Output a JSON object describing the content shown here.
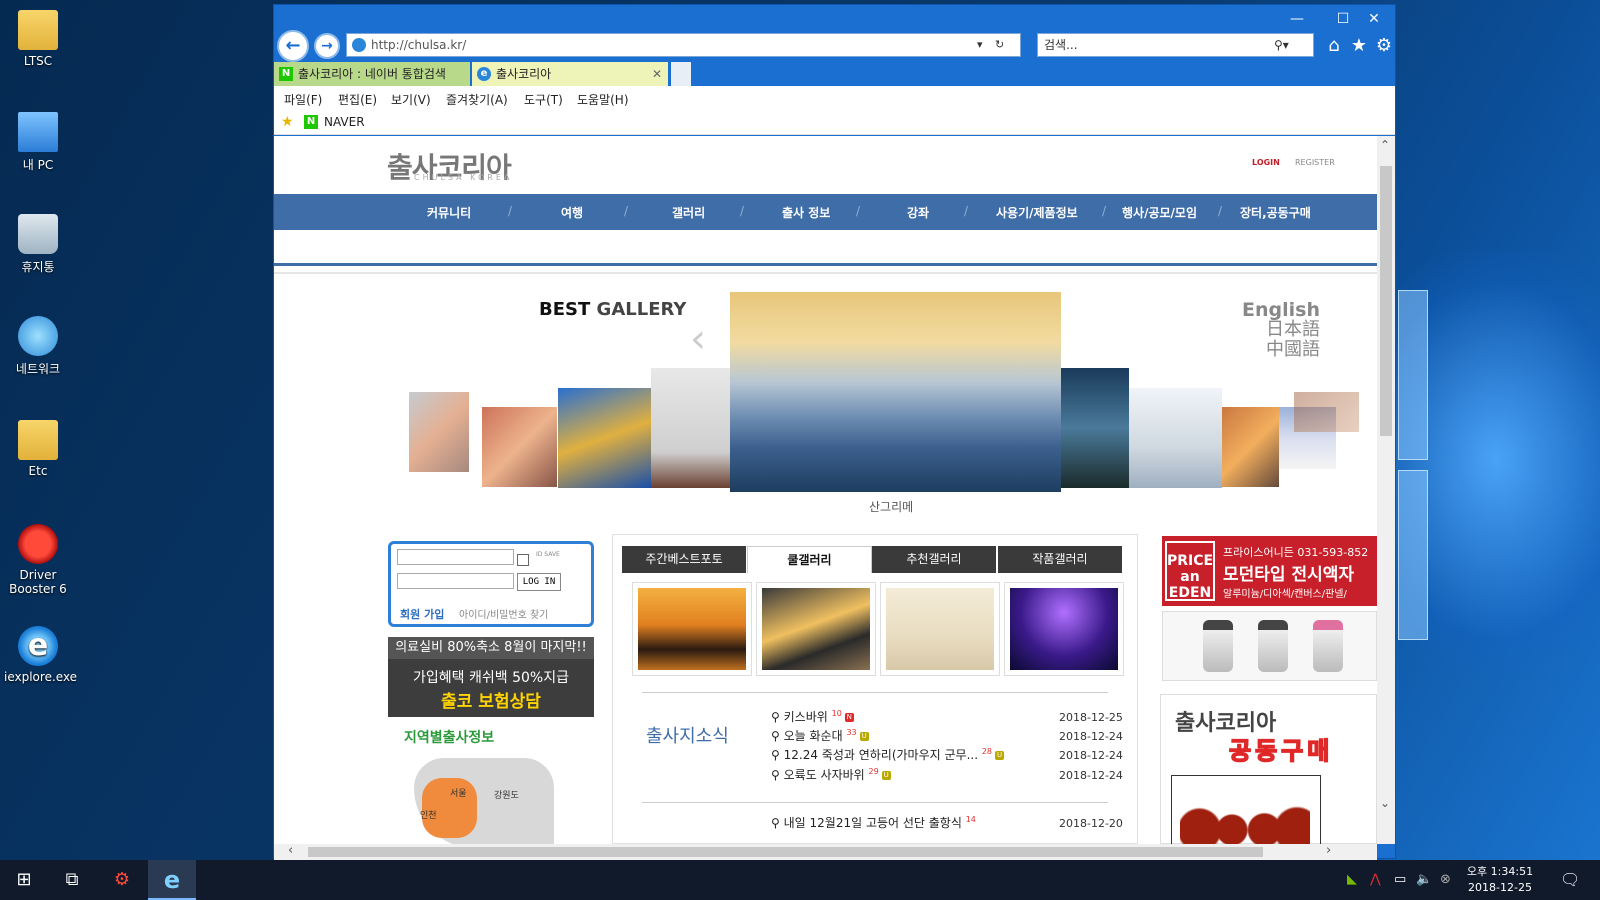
{
  "desktop": {
    "icons": [
      {
        "label": "LTSC",
        "icon": "folder-user-icon"
      },
      {
        "label": "내 PC",
        "icon": "computer-icon"
      },
      {
        "label": "휴지통",
        "icon": "recycle-bin-icon"
      },
      {
        "label": "네트워크",
        "icon": "network-icon"
      },
      {
        "label": "Etc",
        "icon": "folder-icon"
      },
      {
        "label": "Driver Booster 6",
        "icon": "driver-booster-icon"
      },
      {
        "label": "iexplore.exe",
        "icon": "internet-explorer-icon"
      }
    ]
  },
  "browser": {
    "address": "http://chulsa.kr/",
    "search_placeholder": "검색...",
    "tabs": [
      {
        "label": "출사코리아 : 네이버 통합검색",
        "favicon": "N"
      },
      {
        "label": "출사코리아",
        "favicon": "e"
      }
    ],
    "menu": [
      "파일(F)",
      "편집(E)",
      "보기(V)",
      "즐겨찾기(A)",
      "도구(T)",
      "도움말(H)"
    ],
    "favorites": [
      {
        "label": "NAVER",
        "icon": "N"
      }
    ]
  },
  "site": {
    "logo": "출사코리아",
    "logo_sub": "CHULSA KOREA",
    "login": "LOGIN",
    "register": "REGISTER",
    "nav": [
      "커뮤니티",
      "여행",
      "갤러리",
      "출사 정보",
      "강좌",
      "사용기/제품정보",
      "행사/공모/모임",
      "장터,공동구매"
    ],
    "best_gallery": {
      "best": "BEST",
      "gallery": "GALLERY"
    },
    "langs": [
      "English",
      "日本語",
      "中國語"
    ],
    "featured_caption": "산그리메",
    "login_box": {
      "id_save": "ID SAVE",
      "button": "LOG IN",
      "join": "회원 가입",
      "find": "아이디/비밀번호 찾기"
    },
    "insurance": {
      "line1": "의료실비 80%축소 8월이 마지막!!",
      "line2": "가입혜택 캐쉬백 50%지급",
      "line3": "출코 보험상담"
    },
    "region_title": "지역별출사정보",
    "map_labels": [
      "서울",
      "인천",
      "강원도"
    ],
    "gallery_tabs": [
      "주간베스트포토",
      "쿨갤러리",
      "추천갤러리",
      "작품갤러리"
    ],
    "news_title": "출사지소식",
    "news": [
      {
        "title": "키스바위",
        "count": "10",
        "badge": "N",
        "date": "2018-12-25"
      },
      {
        "title": "오늘 화순대",
        "count": "33",
        "badge": "U",
        "date": "2018-12-24"
      },
      {
        "title": "12.24 죽성과 연하리(가마우지 군무...",
        "count": "28",
        "badge": "U",
        "date": "2018-12-24"
      },
      {
        "title": "오륙도 사자바위",
        "count": "29",
        "badge": "U",
        "date": "2018-12-24"
      },
      {
        "title": "내일 12월21일 고등어 선단 출항식",
        "count": "14",
        "badge": "",
        "date": "2018-12-20"
      }
    ],
    "ad_price": {
      "logo": "PRICE an EDEN",
      "line1": "프라이스어니든 031-593-852",
      "line2": "모던타입 전시액자",
      "line3": "알루미늄/디아섹/캔버스/판넬/"
    },
    "ad_group": {
      "line1": "출사코리아",
      "line2": "공동구매"
    }
  },
  "taskbar": {
    "time": "오후 1:34:51",
    "date": "2018-12-25"
  },
  "colors": {
    "nav_blue": "#3f6da8",
    "browser_blue": "#1b6fd1",
    "taskbar": "#101a2a"
  }
}
